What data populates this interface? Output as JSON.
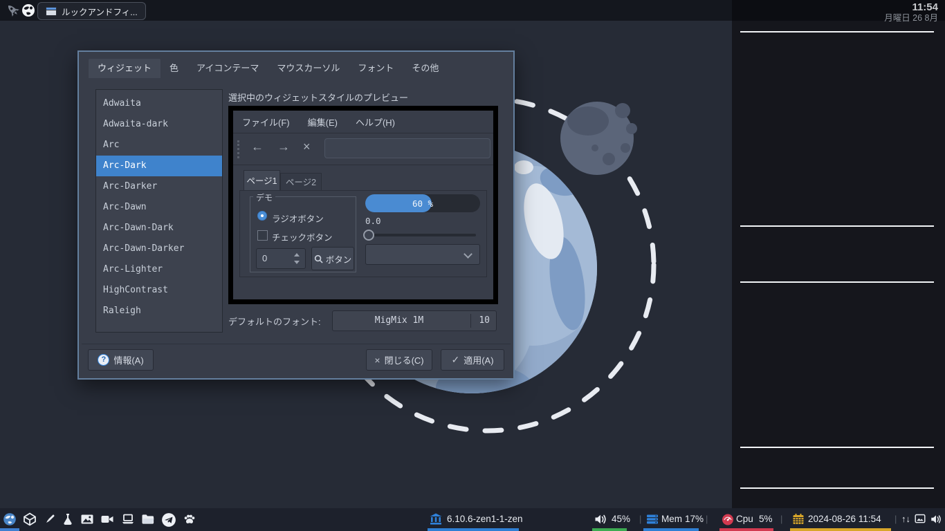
{
  "topbar": {
    "window_title": "ルックアンドフィ..."
  },
  "clock": {
    "time": "11:54",
    "date": "月曜日 26 8月"
  },
  "dialog": {
    "tabs": [
      "ウィジェット",
      "色",
      "アイコンテーマ",
      "マウスカーソル",
      "フォント",
      "その他"
    ],
    "active_tab": "ウィジェット",
    "theme_list": [
      "Adwaita",
      "Adwaita-dark",
      "Arc",
      "Arc-Dark",
      "Arc-Darker",
      "Arc-Dawn",
      "Arc-Dawn-Dark",
      "Arc-Dawn-Darker",
      "Arc-Lighter",
      "HighContrast",
      "Raleigh"
    ],
    "selected_theme": "Arc-Dark",
    "preview_label": "選択中のウィジェットスタイルのプレビュー",
    "preview": {
      "menu": [
        "ファイル(F)",
        "編集(E)",
        "ヘルプ(H)"
      ],
      "page_tabs": [
        "ページ1",
        "ページ2"
      ],
      "group_title": "デモ",
      "radio_label": "ラジオボタン",
      "checkbox_label": "チェックボタン",
      "spin_value": "0",
      "search_button_label": "ボタン",
      "progress_text": "60 %",
      "progress_percent": 60,
      "value_label": "0.0"
    },
    "font_label": "デフォルトのフォント:",
    "font_name": "MigMix 1M",
    "font_size": "10",
    "info_button": "情報(A)",
    "close_button": "閉じる(C)",
    "apply_button": "適用(A)"
  },
  "taskbar": {
    "kernel": "6.10.6-zen1-1-zen",
    "volume": "45%",
    "mem_label": "Mem",
    "mem_value": "17%",
    "cpu_label": "Cpu",
    "cpu_value": "5%",
    "datetime": "2024-08-26 11:54",
    "separator": "|"
  },
  "icons": {
    "back": "←",
    "forward": "→",
    "close": "×",
    "button_close": "×",
    "button_apply": "✓",
    "info": "?",
    "net_arrows": "↑↓"
  },
  "colors": {
    "accent": "#3f83cc",
    "progress_fill": "#4a8bd2",
    "underline_blue": "#2e7fd4",
    "underline_green": "#3cab52",
    "underline_red": "#d23a50",
    "underline_yellow": "#d8a62a"
  }
}
